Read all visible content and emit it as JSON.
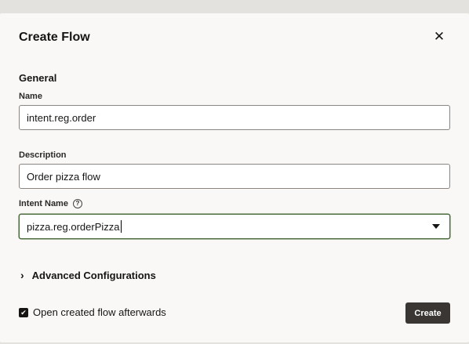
{
  "dialog": {
    "title": "Create Flow",
    "close_icon": "close-icon"
  },
  "general": {
    "heading": "General",
    "name": {
      "label": "Name",
      "value": "intent.reg.order"
    },
    "description": {
      "label": "Description",
      "value": "Order pizza flow"
    },
    "intent": {
      "label": "Intent Name",
      "help_icon": "question-circle-icon",
      "value": "pizza.reg.orderPizza"
    }
  },
  "advanced": {
    "label": "Advanced Configurations",
    "expanded": false
  },
  "open_after": {
    "label": "Open created flow afterwards",
    "checked": true
  },
  "actions": {
    "create": "Create"
  },
  "colors": {
    "primary_button": "#393633",
    "focus_border": "#4b6b3c"
  }
}
